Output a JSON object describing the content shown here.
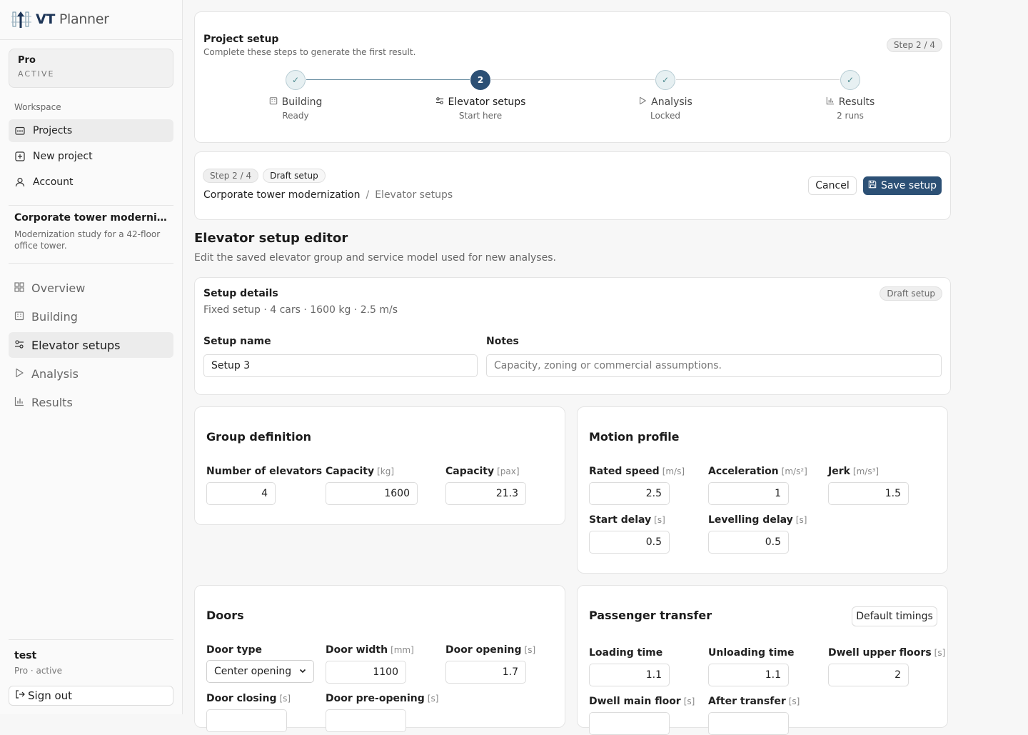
{
  "app": {
    "name_bold": "VT",
    "name_rest": "Planner"
  },
  "plan": {
    "name": "Pro",
    "status": "ACTIVE"
  },
  "workspace": {
    "label": "Workspace",
    "items": [
      {
        "label": "Projects",
        "icon": "folder-icon"
      },
      {
        "label": "New project",
        "icon": "plus-square-icon"
      },
      {
        "label": "Account",
        "icon": "user-icon"
      }
    ]
  },
  "project": {
    "title": "Corporate tower modernizati...",
    "description": "Modernization study for a 42-floor office tower.",
    "nav": [
      {
        "label": "Overview",
        "icon": "grid-icon"
      },
      {
        "label": "Building",
        "icon": "building-icon"
      },
      {
        "label": "Elevator setups",
        "icon": "sliders-icon"
      },
      {
        "label": "Analysis",
        "icon": "play-icon"
      },
      {
        "label": "Results",
        "icon": "bar-chart-icon"
      }
    ]
  },
  "user": {
    "name": "test",
    "plan": "Pro · active",
    "signout": "Sign out"
  },
  "setup_card": {
    "title": "Project setup",
    "subtitle": "Complete these steps to generate the first result.",
    "badge": "Step 2 / 4",
    "steps": [
      {
        "marker": "✓",
        "label": "Building",
        "sub": "Ready"
      },
      {
        "marker": "2",
        "label": "Elevator setups",
        "sub": "Start here"
      },
      {
        "marker": "✓",
        "label": "Analysis",
        "sub": "Locked"
      },
      {
        "marker": "✓",
        "label": "Results",
        "sub": "2 runs"
      }
    ]
  },
  "context_card": {
    "step_badge": "Step 2 / 4",
    "draft_badge": "Draft setup",
    "crumb_project": "Corporate tower modernization",
    "crumb_sep": "/",
    "crumb_page": "Elevator setups",
    "cancel": "Cancel",
    "save": "Save setup"
  },
  "editor": {
    "title": "Elevator setup editor",
    "subtitle": "Edit the saved elevator group and service model used for new analyses."
  },
  "details": {
    "title": "Setup details",
    "summary": "Fixed setup · 4 cars · 1600 kg · 2.5 m/s",
    "badge": "Draft setup",
    "name_label": "Setup name",
    "name_value": "Setup 3",
    "notes_label": "Notes",
    "notes_placeholder": "Capacity, zoning or commercial assumptions."
  },
  "group": {
    "title": "Group definition",
    "elevators": {
      "label": "Number of elevators",
      "value": "4"
    },
    "capacity_kg": {
      "label": "Capacity",
      "unit": "[kg]",
      "value": "1600"
    },
    "capacity_pax": {
      "label": "Capacity",
      "unit": "[pax]",
      "value": "21.3"
    }
  },
  "motion": {
    "title": "Motion profile",
    "speed": {
      "label": "Rated speed",
      "unit": "[m/s]",
      "value": "2.5"
    },
    "accel": {
      "label": "Acceleration",
      "unit": "[m/s²]",
      "value": "1"
    },
    "jerk": {
      "label": "Jerk",
      "unit": "[m/s³]",
      "value": "1.5"
    },
    "start_delay": {
      "label": "Start delay",
      "unit": "[s]",
      "value": "0.5"
    },
    "levelling": {
      "label": "Levelling delay",
      "unit": "[s]",
      "value": "0.5"
    }
  },
  "doors": {
    "title": "Doors",
    "type": {
      "label": "Door type",
      "value": "Center opening"
    },
    "width": {
      "label": "Door width",
      "unit": "[mm]",
      "value": "1100"
    },
    "opening": {
      "label": "Door opening",
      "unit": "[s]",
      "value": "1.7"
    },
    "closing": {
      "label": "Door closing",
      "unit": "[s]"
    },
    "preopening": {
      "label": "Door pre-opening",
      "unit": "[s]"
    }
  },
  "transfer": {
    "title": "Passenger transfer",
    "default_btn": "Default timings",
    "loading": {
      "label": "Loading time",
      "value": "1.1"
    },
    "unloading": {
      "label": "Unloading time",
      "value": "1.1"
    },
    "dwell_upper": {
      "label": "Dwell upper floors",
      "unit": "[s]",
      "value": "2"
    },
    "dwell_main": {
      "label": "Dwell main floor",
      "unit": "[s]"
    },
    "after": {
      "label": "After transfer",
      "unit": "[s]"
    }
  }
}
